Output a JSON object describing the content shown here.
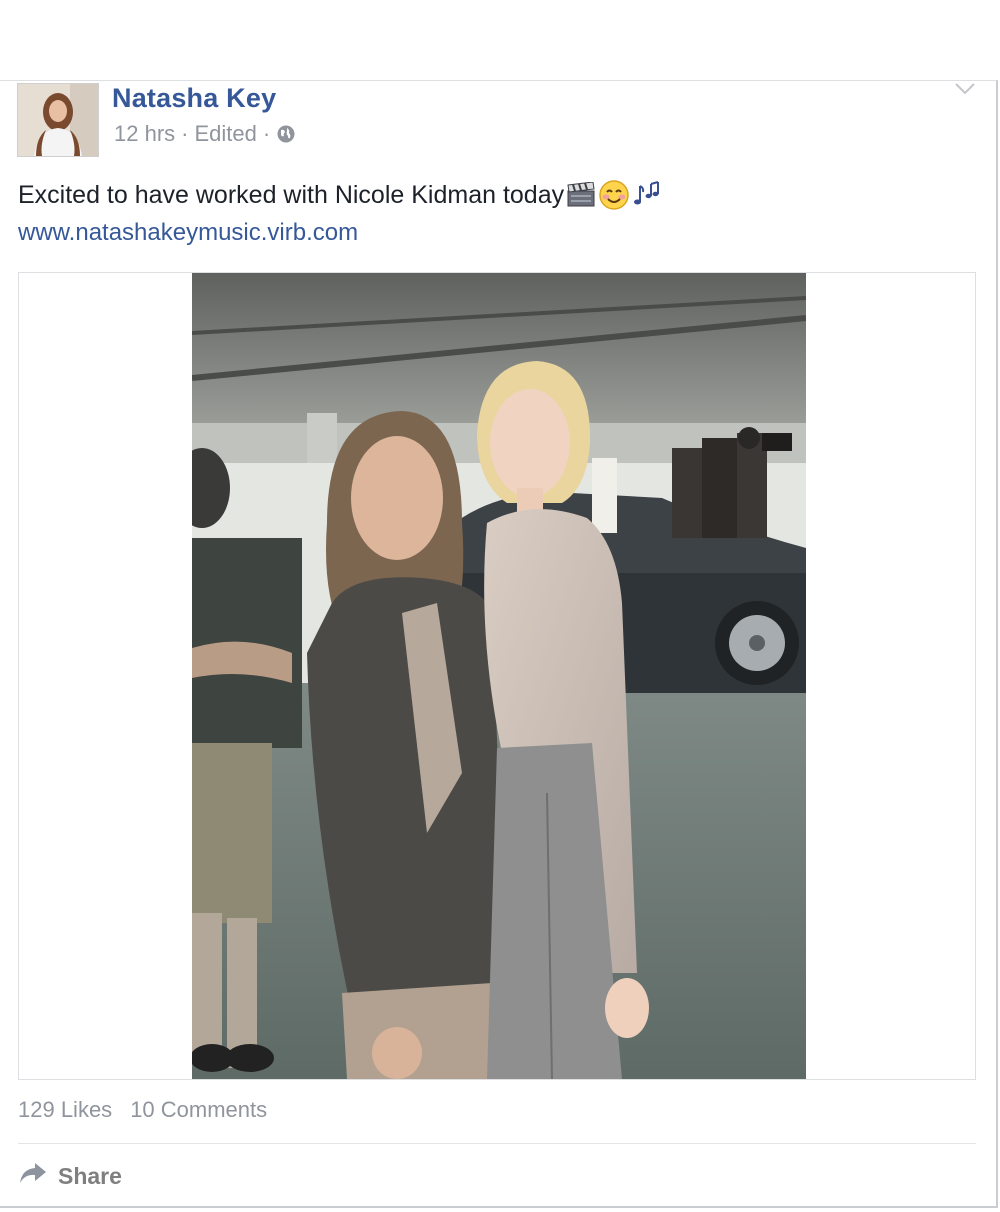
{
  "post": {
    "author": "Natasha Key",
    "time": "12 hrs",
    "edited": "Edited",
    "separator": "·",
    "text": "Excited to have worked with Nicole Kidman today",
    "link": "www.natashakeymusic.virb.com"
  },
  "stats": {
    "likes": "129 Likes",
    "comments": "10 Comments"
  },
  "actions": {
    "share": "Share"
  },
  "icons": {
    "privacy": "globe-icon",
    "menu": "chevron-down-icon",
    "share": "share-arrow-icon",
    "emoji": [
      "clapperboard-emoji",
      "smile-emoji",
      "music-notes-emoji"
    ]
  },
  "colors": {
    "link": "#365899",
    "meta": "#90949c",
    "text": "#1d2129"
  }
}
